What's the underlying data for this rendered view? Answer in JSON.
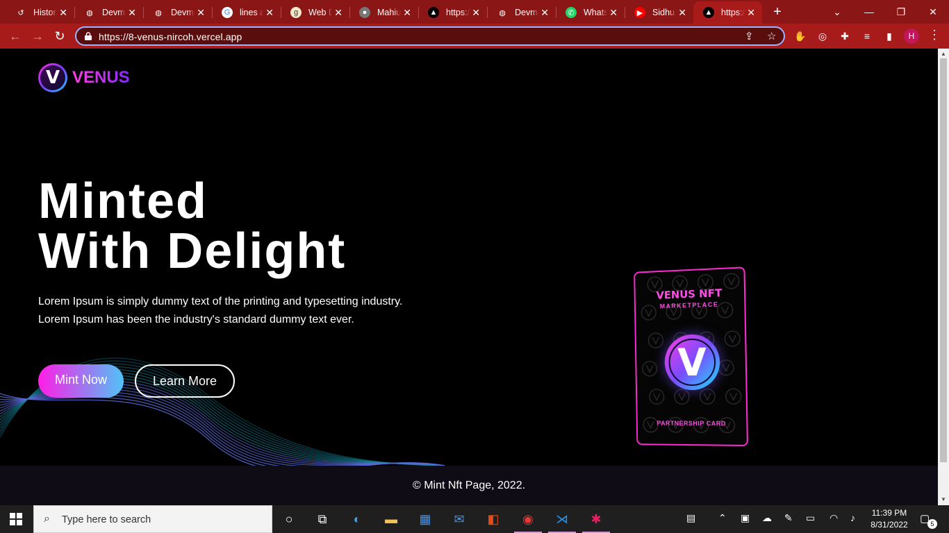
{
  "browser": {
    "tabs": [
      {
        "title": "History",
        "icon": "history-icon"
      },
      {
        "title": "Devmate",
        "icon": "globe-icon"
      },
      {
        "title": "Devmate",
        "icon": "globe-icon"
      },
      {
        "title": "lines a",
        "icon": "google-icon"
      },
      {
        "title": "Web D",
        "icon": "grammarly-icon"
      },
      {
        "title": "Mahiu",
        "icon": "avatar-icon"
      },
      {
        "title": "https:/",
        "icon": "vercel-icon"
      },
      {
        "title": "Devma",
        "icon": "globe-icon"
      },
      {
        "title": "Whats",
        "icon": "whatsapp-icon"
      },
      {
        "title": "Sidhu",
        "icon": "youtube-icon"
      },
      {
        "title": "https:/",
        "icon": "vercel-icon"
      }
    ],
    "active_tab_index": 10,
    "url": "https://8-venus-nircoh.vercel.app",
    "profile_initial": "H",
    "accent": "#a71b1b"
  },
  "site": {
    "brand": "VENUS",
    "logo_letter": "V",
    "hero_line1": "Minted",
    "hero_line2": "With Delight",
    "hero_text": "Lorem Ipsum is simply dummy text of the printing and typesetting industry. Lorem Ipsum has been the industry's standard dummy text ever.",
    "btn_mint": "Mint Now",
    "btn_learn": "Learn More",
    "card": {
      "title": "VENUS NFT",
      "subtitle": "MARKETPLACE",
      "coin_letter": "V",
      "footer": "PARTNERSHIP CARD"
    },
    "footer": "© Mint Nft Page, 2022.",
    "colors": {
      "pink": "#ff1de6",
      "cyan": "#4fc3f7",
      "purple": "#8a2bff"
    }
  },
  "taskbar": {
    "search_placeholder": "Type here to search",
    "time": "11:39 PM",
    "date": "8/31/2022",
    "notification_count": "5"
  }
}
